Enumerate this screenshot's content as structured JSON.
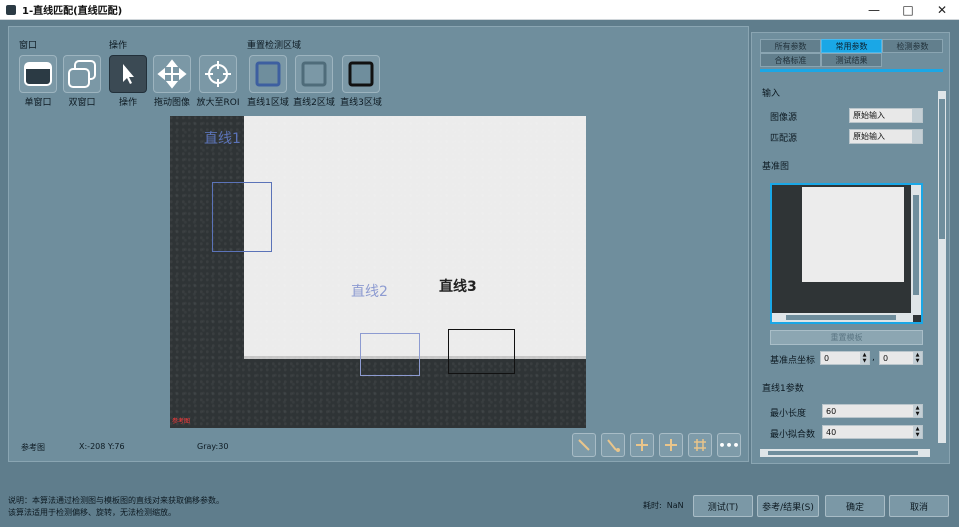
{
  "window": {
    "title": "1-直线匹配(直线匹配)",
    "controls": [
      "—",
      "□",
      "✕"
    ]
  },
  "toolbar": {
    "window_group_label": "窗口",
    "op_group_label": "操作",
    "reset_group_label": "重置检测区域",
    "single_window": "单窗口",
    "dual_window": "双窗口",
    "operate": "操作",
    "drag_image": "拖动图像",
    "zoom_roi": "放大至ROI",
    "line1_area": "直线1区域",
    "line2_area": "直线2区域",
    "line3_area": "直线3区域"
  },
  "canvas": {
    "line1_label": "直线1",
    "line2_label": "直线2",
    "line3_label": "直线3",
    "ref_tag": "参考图",
    "colors": {
      "line1": "#5b73b8",
      "line2": "#8d9bd1",
      "line3": "#222222",
      "background": "#2f3436",
      "plate": "#ececec"
    }
  },
  "status": {
    "image_name": "参考图",
    "coords": "X:-208 Y:76",
    "gray": "Gray:30"
  },
  "image_tools": [
    "line-tool-1",
    "line-tool-2",
    "add-tool",
    "add-tool-2",
    "grid-tool",
    "more"
  ],
  "right_panel": {
    "tabs": [
      "所有参数",
      "常用参数",
      "检测参数",
      "合格标准",
      "测试结果"
    ],
    "active_tab": "常用参数",
    "input_section": "输入",
    "image_source_label": "图像源",
    "image_source_value": "原始输入",
    "match_source_label": "匹配源",
    "match_source_value": "原始输入",
    "base_image_label": "基准图",
    "reset_template_btn": "重置模板",
    "ref_point_label": "基准点坐标",
    "ref_point_x": "0",
    "ref_point_sep": ",",
    "ref_point_y": "0",
    "line1_params_label": "直线1参数",
    "min_length_label": "最小长度",
    "min_length_value": "60",
    "min_fit_label": "最小拟合数",
    "min_fit_value": "40"
  },
  "footer": {
    "note_line1": "说明：本算法通过检测图与模板图的直线对来获取偏移参数。",
    "note_line2": "该算法适用于检测偏移、旋转，无法检测缩放。",
    "elapsed_label": "耗时:",
    "elapsed_value": "NaN",
    "test_btn": "测试(T)",
    "ref_result_btn": "参考/结果(S)",
    "ok_btn": "确定",
    "cancel_btn": "取消"
  }
}
